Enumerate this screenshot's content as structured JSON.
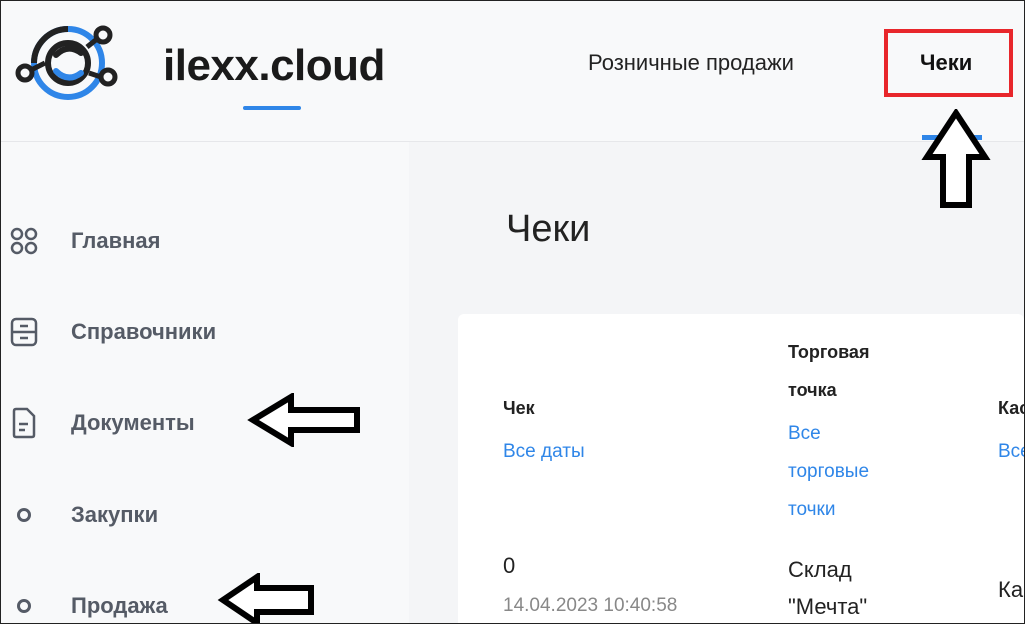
{
  "header": {
    "brand": "ilexx.cloud",
    "nav": [
      {
        "label": "Розничные продажи"
      },
      {
        "label": "Чеки"
      }
    ]
  },
  "sidebar": {
    "items": [
      {
        "label": "Главная",
        "icon": "grid-icon"
      },
      {
        "label": "Справочники",
        "icon": "cabinet-icon"
      },
      {
        "label": "Документы",
        "icon": "document-icon"
      },
      {
        "label": "Закупки",
        "icon": "circle-icon"
      },
      {
        "label": "Продажа",
        "icon": "circle-icon"
      }
    ]
  },
  "main": {
    "title": "Чеки",
    "table": {
      "columns": [
        {
          "header": "Чек",
          "filter": "Все даты"
        },
        {
          "header_lines": [
            "Торговая",
            "точка"
          ],
          "filter_lines": [
            "Все",
            "торговые",
            "точки"
          ]
        },
        {
          "header": "Кас",
          "filter": "Все"
        }
      ],
      "rows": [
        {
          "check_number": "0",
          "check_datetime": "14.04.2023 10:40:58",
          "store_lines": [
            "Склад",
            "\"Мечта\""
          ],
          "cash": "Ка"
        }
      ]
    }
  },
  "colors": {
    "accent": "#2f86e8",
    "highlight": "#e8262b"
  }
}
